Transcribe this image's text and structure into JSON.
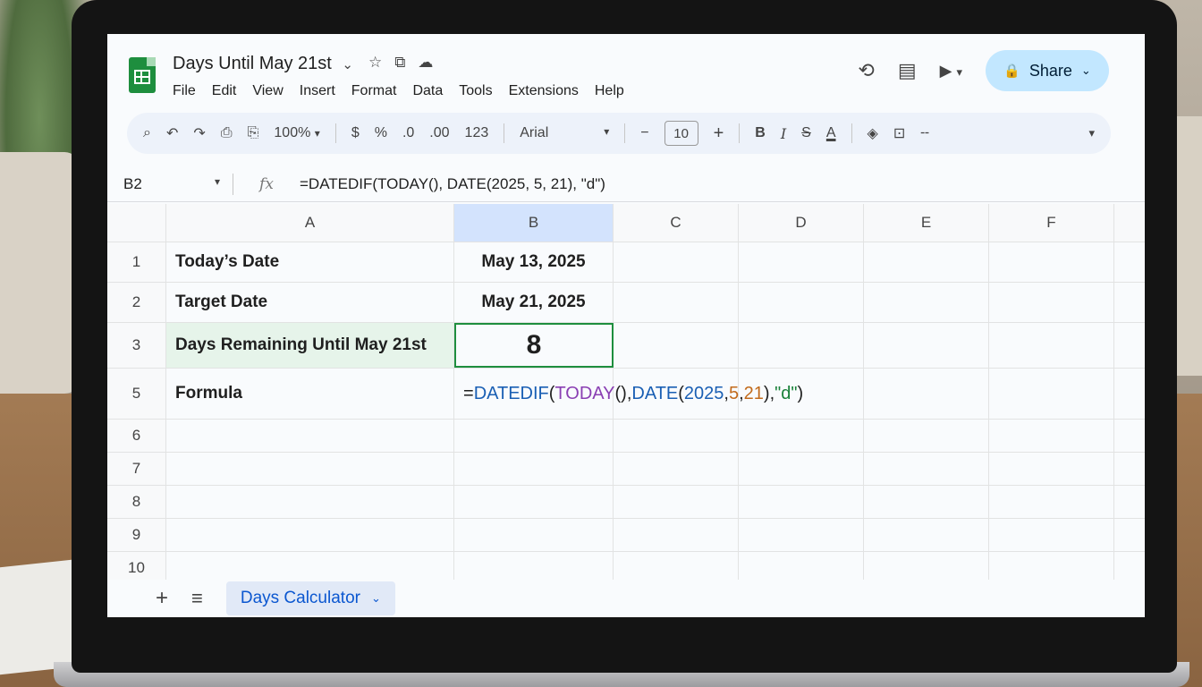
{
  "header": {
    "title": "Days Until May 21st",
    "title_dropdown": "⌄",
    "star_icon": "☆",
    "move_icon": "⧉",
    "cloud_icon": "☁",
    "menu": [
      "File",
      "Edit",
      "View",
      "Insert",
      "Format",
      "Data",
      "Tools",
      "Extensions",
      "Help"
    ],
    "share_label": "Share",
    "share_lock": "🔒",
    "share_chevron": "⌄",
    "history_icon": "⟲",
    "comment_icon": "▤",
    "meet_icon": "▶"
  },
  "toolbar": {
    "zoom": "100%",
    "currency": "$",
    "percent": "%",
    "dec_dec": ".0",
    "dec_inc": ".00",
    "num_fmt": "123",
    "font": "Arial",
    "font_size": "10",
    "minus": "−",
    "plus": "+",
    "bold": "B",
    "italic": "I",
    "strike": "S",
    "text_color": "A"
  },
  "formula_bar": {
    "cell_ref": "B2",
    "fx": "fx",
    "formula": "=DATEDIF(TODAY(), DATE(2025, 5, 21), \"d\")"
  },
  "columns": [
    "A",
    "B",
    "C",
    "D",
    "E",
    "F"
  ],
  "rows": [
    {
      "num": "1",
      "a": "Today’s Date",
      "b": "May 13, 2025"
    },
    {
      "num": "2",
      "a": "Target Date",
      "b": "May 21, 2025"
    },
    {
      "num": "3",
      "a": "Days Remaining Until May 21st",
      "b": "8"
    },
    {
      "num": "5",
      "a": "Formula",
      "b": ""
    },
    {
      "num": "6"
    },
    {
      "num": "7"
    },
    {
      "num": "8"
    },
    {
      "num": "9"
    },
    {
      "num": "10"
    }
  ],
  "formula_display": {
    "eq": "=",
    "fn1": "DATEDIF",
    "p1": "(",
    "fn2": "TODAY",
    "p2": "(), ",
    "fn3": "DATE",
    "p3": "(",
    "n1": "2025",
    "c1": ", ",
    "n2": "5",
    "c2": ", ",
    "n3": "21",
    "p4": "), ",
    "s": "\"d\"",
    "p5": ")"
  },
  "sheets": {
    "add": "+",
    "list": "≡",
    "active": "Days Calculator",
    "chevron": "⌄"
  },
  "colors": {
    "accent_green": "#1e8e3e",
    "share_bg": "#c2e7ff",
    "highlight": "#e6f4ea"
  }
}
